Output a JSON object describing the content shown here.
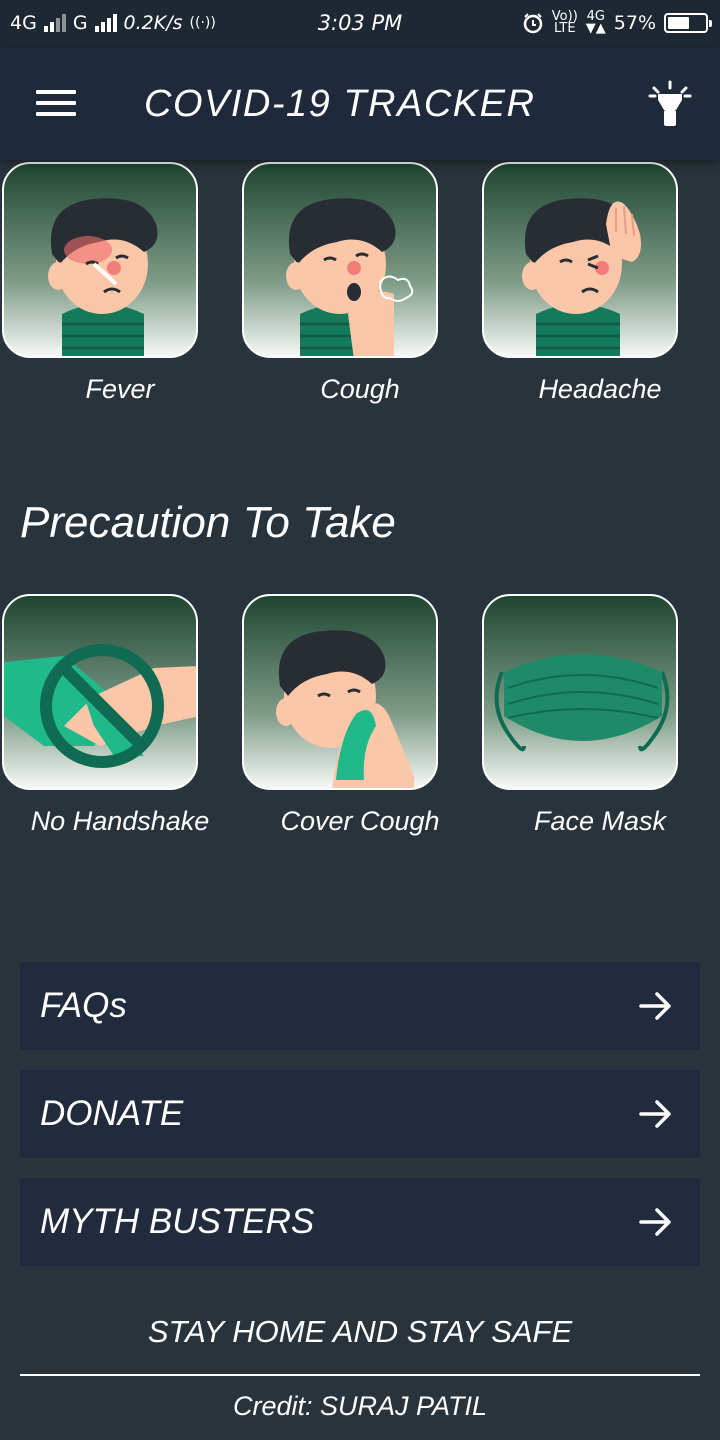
{
  "status_bar": {
    "network1": "4G",
    "network2": "G",
    "speed": "0.2K/s",
    "time": "3:03 PM",
    "volte_top": "Vo))",
    "volte_bottom": "LTE",
    "net_top": "4G",
    "battery_percent": "57%",
    "battery_level": 0.57
  },
  "app_bar": {
    "title": "COVID-19 TRACKER"
  },
  "symptoms": [
    {
      "label": "Fever",
      "icon": "fever-icon"
    },
    {
      "label": "Cough",
      "icon": "cough-icon"
    },
    {
      "label": "Headache",
      "icon": "headache-icon"
    }
  ],
  "precautions": {
    "heading": "Precaution To Take",
    "items": [
      {
        "label": "No Handshake",
        "icon": "no-handshake-icon"
      },
      {
        "label": "Cover Cough",
        "icon": "cover-cough-icon"
      },
      {
        "label": "Face Mask",
        "icon": "face-mask-icon"
      }
    ]
  },
  "links": [
    {
      "label": "FAQs"
    },
    {
      "label": "DONATE"
    },
    {
      "label": "MYTH BUSTERS"
    }
  ],
  "footer": {
    "slogan": "STAY HOME AND STAY SAFE",
    "credit": "Credit: SURAJ PATIL"
  },
  "colors": {
    "background": "#29333b",
    "app_bar": "#1e2a3b",
    "button": "#212b3d",
    "green": "#1e8a67",
    "skin": "#fbc7a8"
  }
}
